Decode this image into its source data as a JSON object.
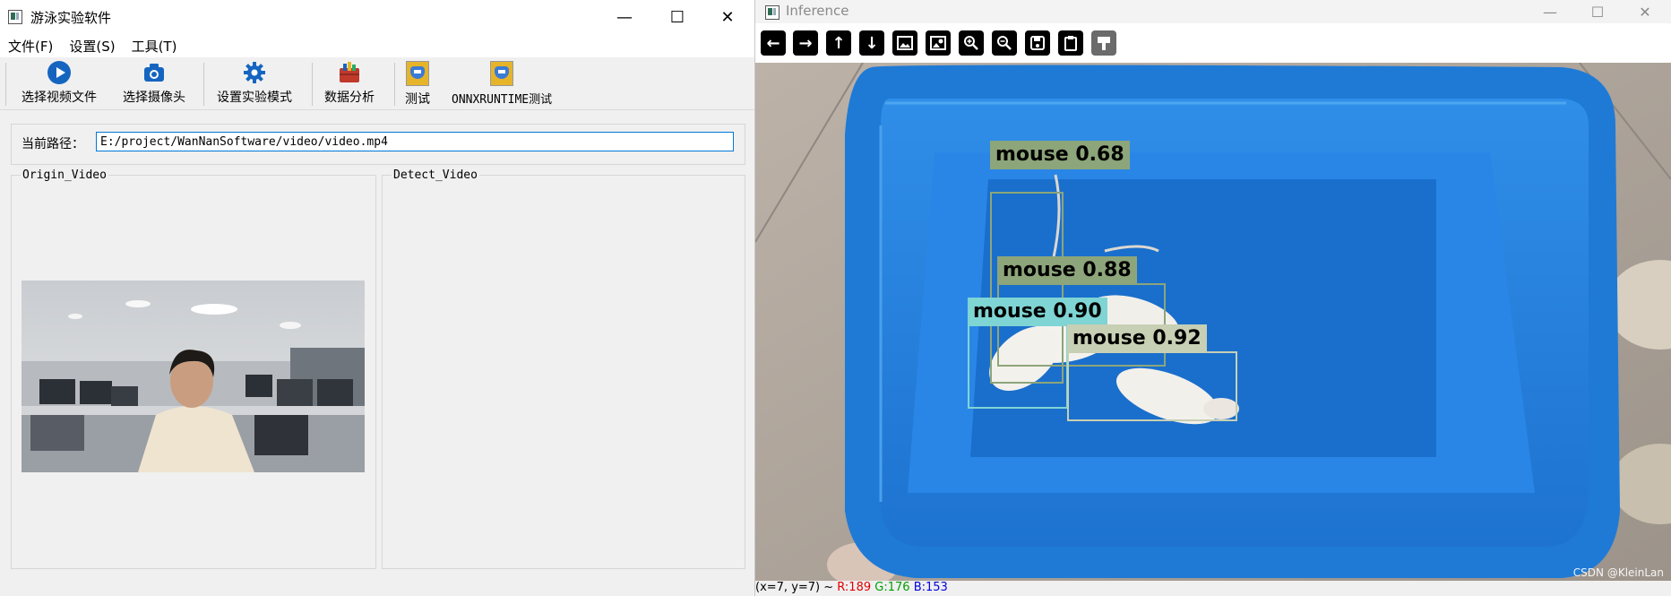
{
  "left_window": {
    "title": "游泳实验软件",
    "controls": {
      "minimize": "—",
      "maximize": "☐",
      "close": "✕"
    },
    "menu": [
      "文件(F)",
      "设置(S)",
      "工具(T)"
    ],
    "toolbar": [
      {
        "label": "选择视频文件",
        "icon": "play-icon"
      },
      {
        "label": "选择摄像头",
        "icon": "camera-icon"
      },
      {
        "label": "设置实验模式",
        "icon": "gear-icon"
      },
      {
        "label": "数据分析",
        "icon": "chart-icon"
      },
      {
        "label": "测试",
        "icon": "app-image-icon"
      },
      {
        "label": "ONNXRUNTIME测试",
        "icon": "app-image-icon"
      }
    ],
    "path_label": "当前路径：",
    "path_value": "E:/project/WanNanSoftware/video/video.mp4",
    "origin_group_title": "Origin_Video",
    "detect_group_title": "Detect_Video"
  },
  "right_window": {
    "title": "Inference",
    "controls": {
      "minimize": "—",
      "maximize": "☐",
      "close": "✕"
    },
    "tools": [
      "back-arrow-icon",
      "forward-arrow-icon",
      "up-arrow-icon",
      "down-arrow-icon",
      "image-icon",
      "image-settings-icon",
      "zoom-in-icon",
      "zoom-out-icon",
      "save-icon",
      "clipboard-icon",
      "paint-icon"
    ],
    "detections": [
      {
        "label": "mouse  0.68",
        "color": "#8da57a"
      },
      {
        "label": "mouse  0.88",
        "color": "#8da57a"
      },
      {
        "label": "mouse  0.90",
        "color": "#7fd4d4"
      },
      {
        "label": "mouse  0.92",
        "color": "#c7cfb4"
      }
    ],
    "status": {
      "coords": "(x=7, y=7) ~",
      "r": "R:189",
      "g": "G:176",
      "b": "B:153",
      "r_color": "#e00000",
      "g_color": "#00a000",
      "b_color": "#0000e0"
    },
    "watermark": "CSDN @KleinLan"
  }
}
